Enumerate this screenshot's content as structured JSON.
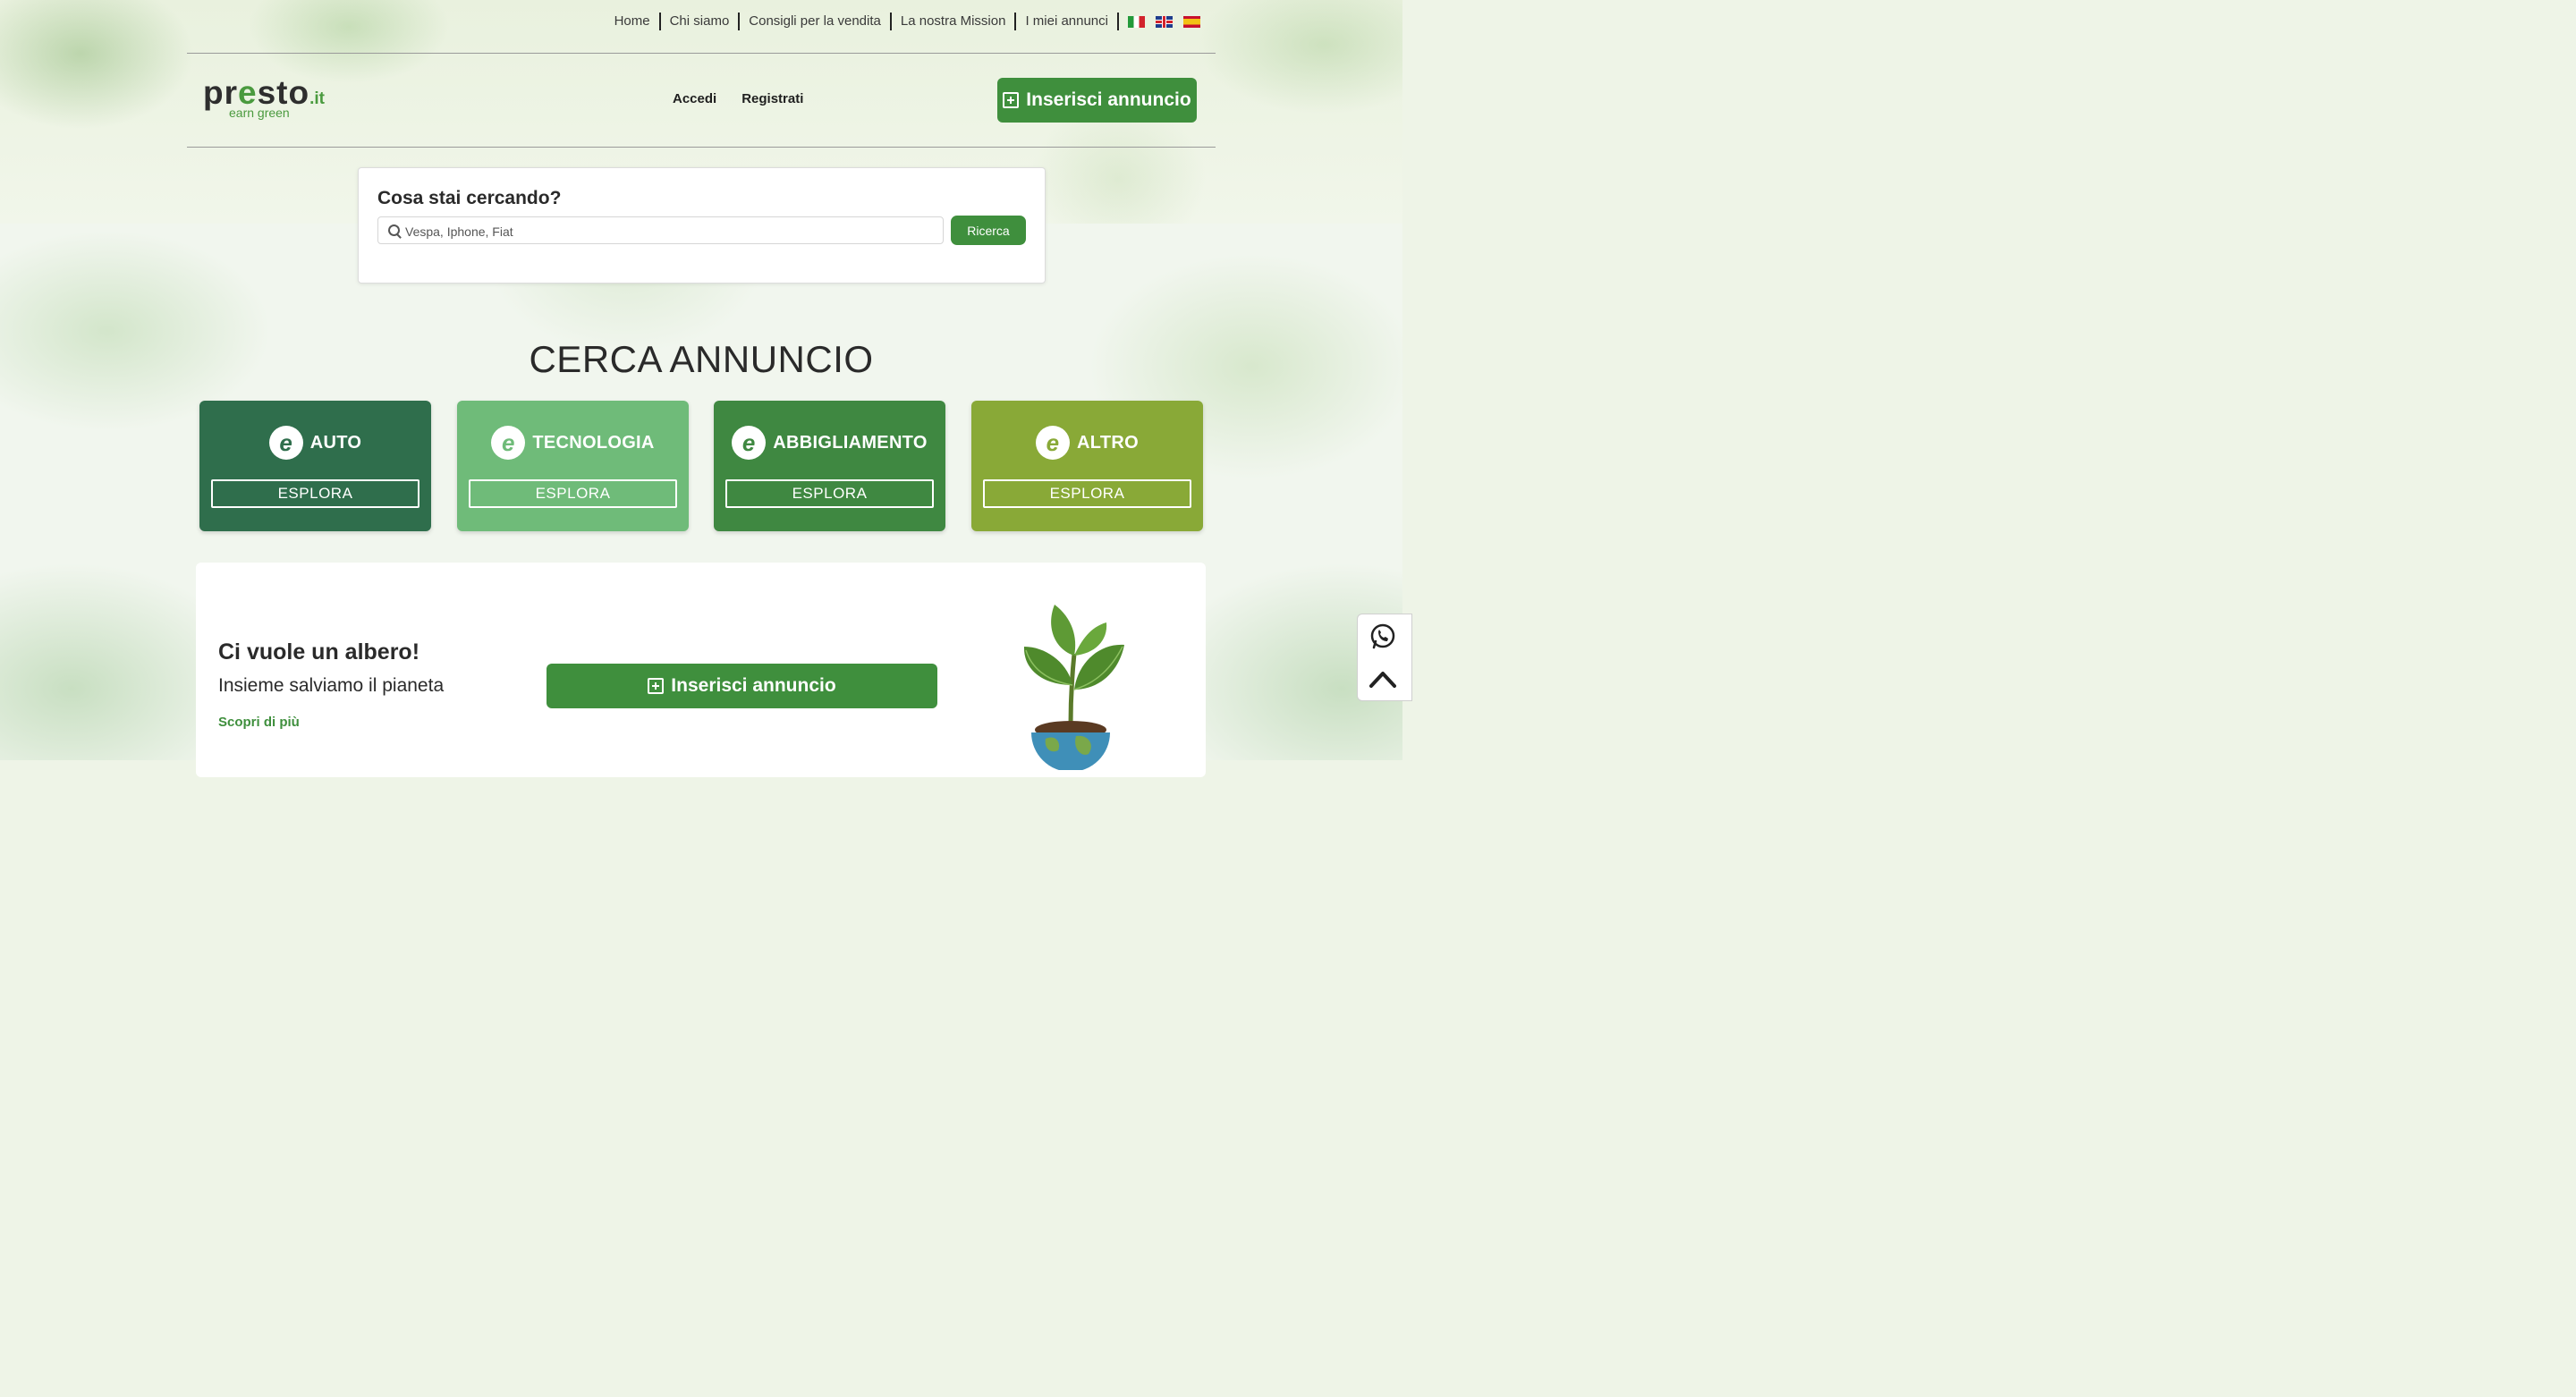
{
  "topnav": {
    "items": [
      "Home",
      "Chi siamo",
      "Consigli per la vendita",
      "La nostra Mission",
      "I miei annunci"
    ]
  },
  "languages": [
    "it",
    "en",
    "es"
  ],
  "brand": {
    "name_left": "pr",
    "name_e": "e",
    "name_right": "sto",
    "tld": ".it",
    "tagline": "earn green"
  },
  "auth": {
    "login": "Accedi",
    "register": "Registrati"
  },
  "header_cta": "Inserisci annuncio",
  "search": {
    "title": "Cosa stai cercando?",
    "placeholder": "Vespa, Iphone, Fiat",
    "value": "",
    "button": "Ricerca"
  },
  "section_title": "CERCA ANNUNCIO",
  "categories": [
    {
      "label": "AUTO",
      "button": "ESPLORA",
      "color": "#2f6e4c"
    },
    {
      "label": "TECNOLOGIA",
      "button": "ESPLORA",
      "color": "#6fbb79"
    },
    {
      "label": "ABBIGLIAMENTO",
      "button": "ESPLORA",
      "color": "#3f8841"
    },
    {
      "label": "ALTRO",
      "button": "ESPLORA",
      "color": "#89a937"
    }
  ],
  "tree_section": {
    "title": "Ci vuole un albero!",
    "subtitle": "Insieme salviamo il pianeta",
    "link": "Scopri di più",
    "cta": "Inserisci annuncio"
  },
  "colors": {
    "brand_green": "#3f8f3d"
  },
  "side_actions": [
    "whatsapp-icon",
    "scroll-top-icon"
  ]
}
